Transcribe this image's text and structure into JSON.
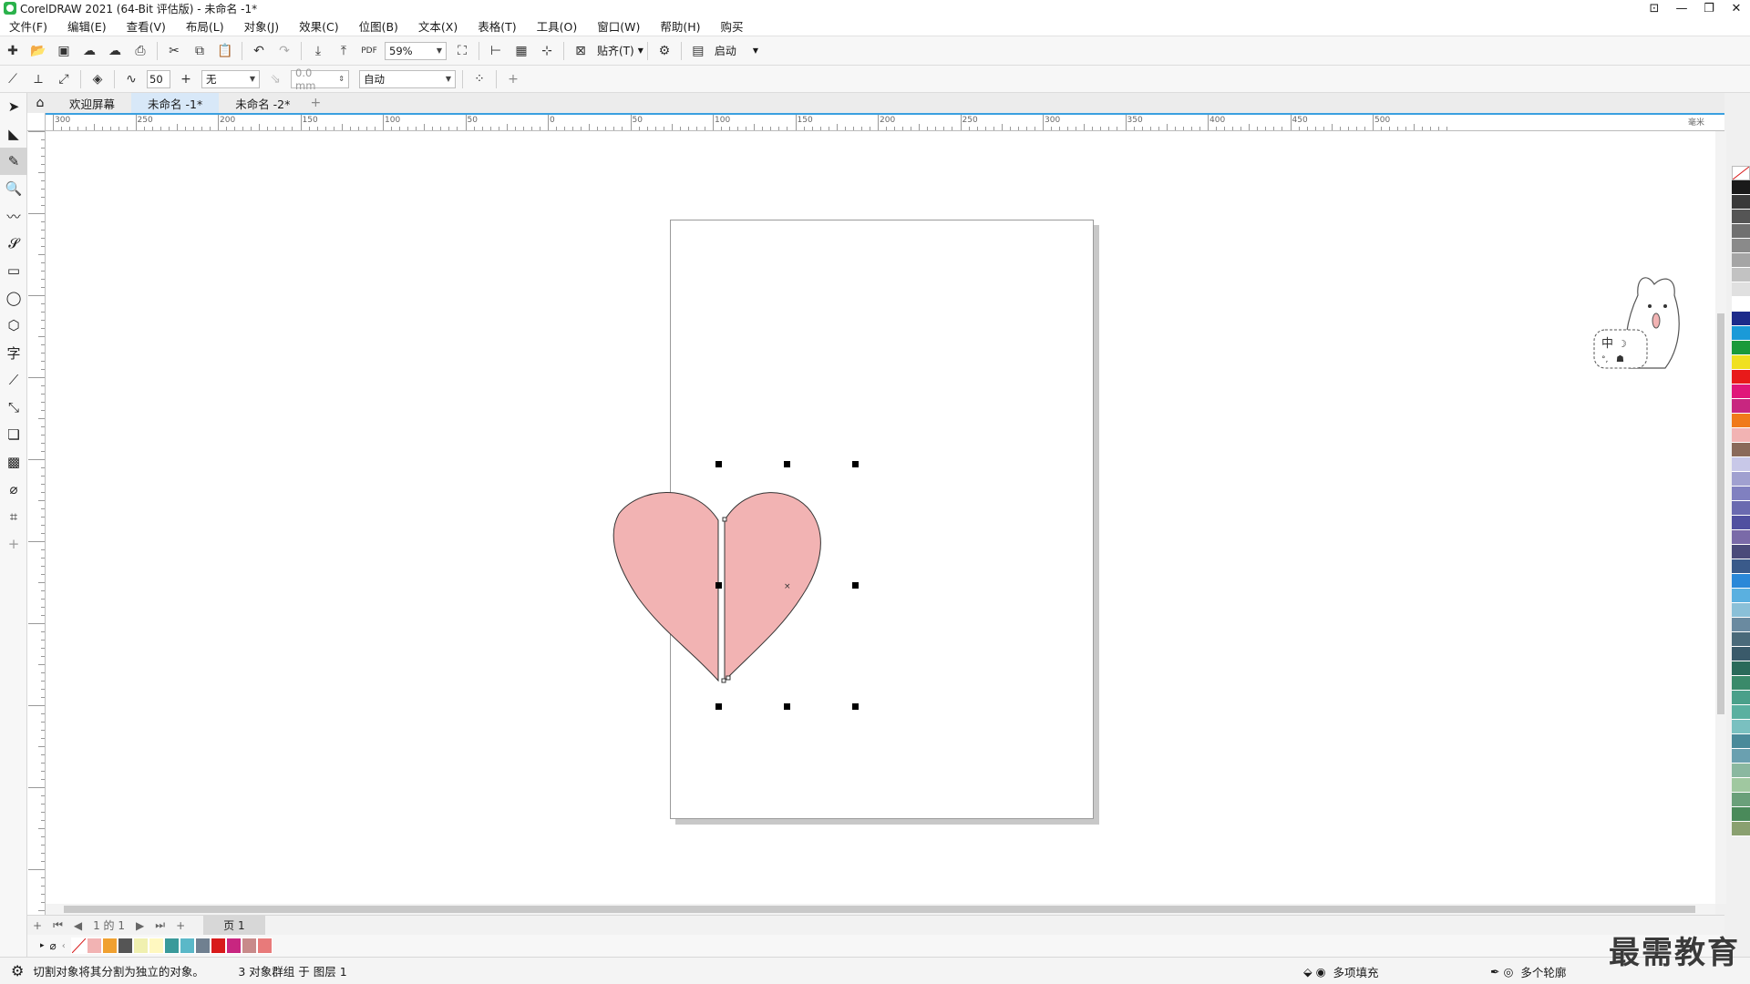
{
  "window": {
    "title": "CorelDRAW 2021 (64-Bit 评估版) - 未命名 -1*"
  },
  "menu": [
    "文件(F)",
    "编辑(E)",
    "查看(V)",
    "布局(L)",
    "对象(J)",
    "效果(C)",
    "位图(B)",
    "文本(X)",
    "表格(T)",
    "工具(O)",
    "窗口(W)",
    "帮助(H)",
    "购买"
  ],
  "toolbar1": {
    "zoom": "59%",
    "snap_label": "贴齐(T)",
    "launch_label": "启动"
  },
  "toolbar2": {
    "smooth_value": "50",
    "outline_style": "无",
    "outline_width": "0.0 mm",
    "mode": "自动"
  },
  "tabs": {
    "welcome": "欢迎屏幕",
    "doc1": "未命名 -1*",
    "doc2": "未命名 -2*"
  },
  "ruler": {
    "labels": [
      "300",
      "250",
      "200",
      "150",
      "100",
      "50",
      "0",
      "50",
      "100",
      "150",
      "200",
      "250",
      "300",
      "350",
      "400",
      "450",
      "500"
    ],
    "unit": "毫米"
  },
  "pagenav": {
    "page_of": "1 的 1",
    "page_tab": "页 1"
  },
  "status": {
    "message": "切割对象将其分割为独立的对象。",
    "selection": "3 对象群组 于 图层 1",
    "fill_label": "多项填充",
    "outline_label": "多个轮廓"
  },
  "colors": {
    "heart_fill": "#f2b3b3",
    "accent": "#3aa0e0",
    "palette": [
      "#1a1a1a",
      "#3a3a3a",
      "#555555",
      "#707070",
      "#8a8a8a",
      "#a5a5a5",
      "#c2c2c2",
      "#e0e0e0",
      "#ffffff",
      "#1c2a8a",
      "#1a9ad8",
      "#1a9a3a",
      "#f0e020",
      "#e81a1a",
      "#e0167a",
      "#c82680",
      "#f07a1a",
      "#f2b3b3",
      "#8a6a5a",
      "#c8c8e8",
      "#a0a0d0",
      "#8080c0",
      "#6a6ab0",
      "#5050a0",
      "#7a6aa8",
      "#4a4a7a",
      "#3a5a8a",
      "#2a88d8",
      "#5ab0e0",
      "#8ac0d8",
      "#6a8aa0",
      "#4a6a7a",
      "#3a5a6a",
      "#2a6a5a",
      "#3a8a6a",
      "#4aa08a",
      "#5ab0a0",
      "#7ac0c0",
      "#4a8a9a",
      "#6aa0b0",
      "#8ab8a0",
      "#a0c8a0",
      "#6aa07a",
      "#4a8a5a",
      "#8aa070"
    ],
    "doc_palette": [
      "#f2b3b3",
      "#f0a030",
      "#555555",
      "#f0f0b0",
      "#fff8c0",
      "#3a9a9a",
      "#5ab8c8",
      "#708090",
      "#d81a1a",
      "#c82680",
      "#c88a8a",
      "#e87a7a"
    ]
  },
  "watermark": "最需教育"
}
